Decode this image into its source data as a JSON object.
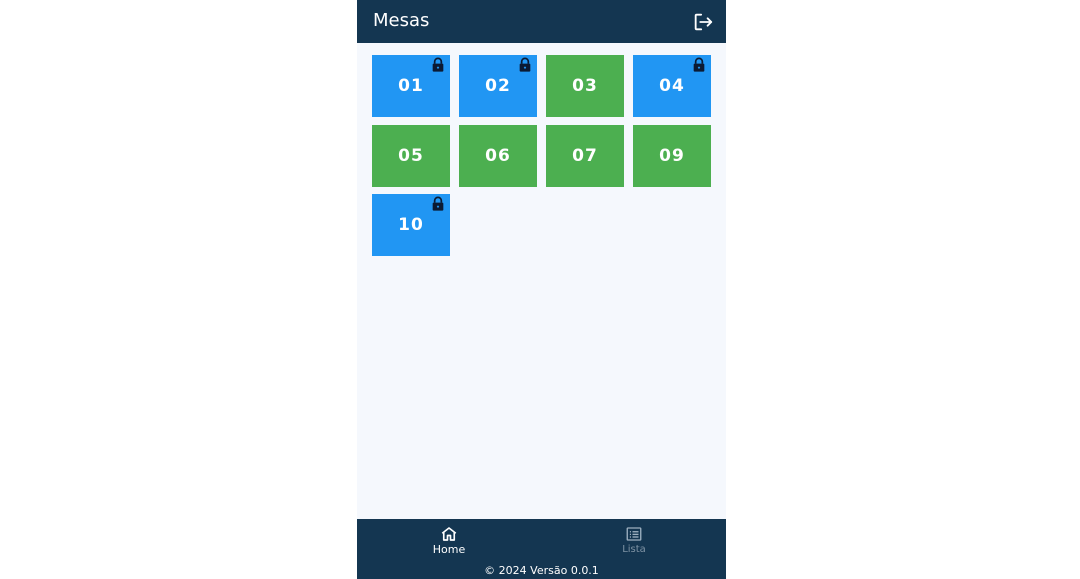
{
  "header": {
    "title": "Mesas",
    "logout_icon": "logout-icon"
  },
  "tables": [
    {
      "number": "01",
      "status": "busy",
      "locked": true
    },
    {
      "number": "02",
      "status": "busy",
      "locked": true
    },
    {
      "number": "03",
      "status": "free",
      "locked": false
    },
    {
      "number": "04",
      "status": "busy",
      "locked": true
    },
    {
      "number": "05",
      "status": "free",
      "locked": false
    },
    {
      "number": "06",
      "status": "free",
      "locked": false
    },
    {
      "number": "07",
      "status": "free",
      "locked": false
    },
    {
      "number": "09",
      "status": "free",
      "locked": false
    },
    {
      "number": "10",
      "status": "busy",
      "locked": true
    }
  ],
  "colors": {
    "header_bg": "#143651",
    "busy": "#2196f3",
    "free": "#4caf50",
    "background": "#f5f8fd"
  },
  "bottom_nav": {
    "items": [
      {
        "label": "Home",
        "icon": "home-icon",
        "active": true
      },
      {
        "label": "Lista",
        "icon": "list-icon",
        "active": false
      }
    ],
    "footer": "© 2024 Versão 0.0.1"
  }
}
